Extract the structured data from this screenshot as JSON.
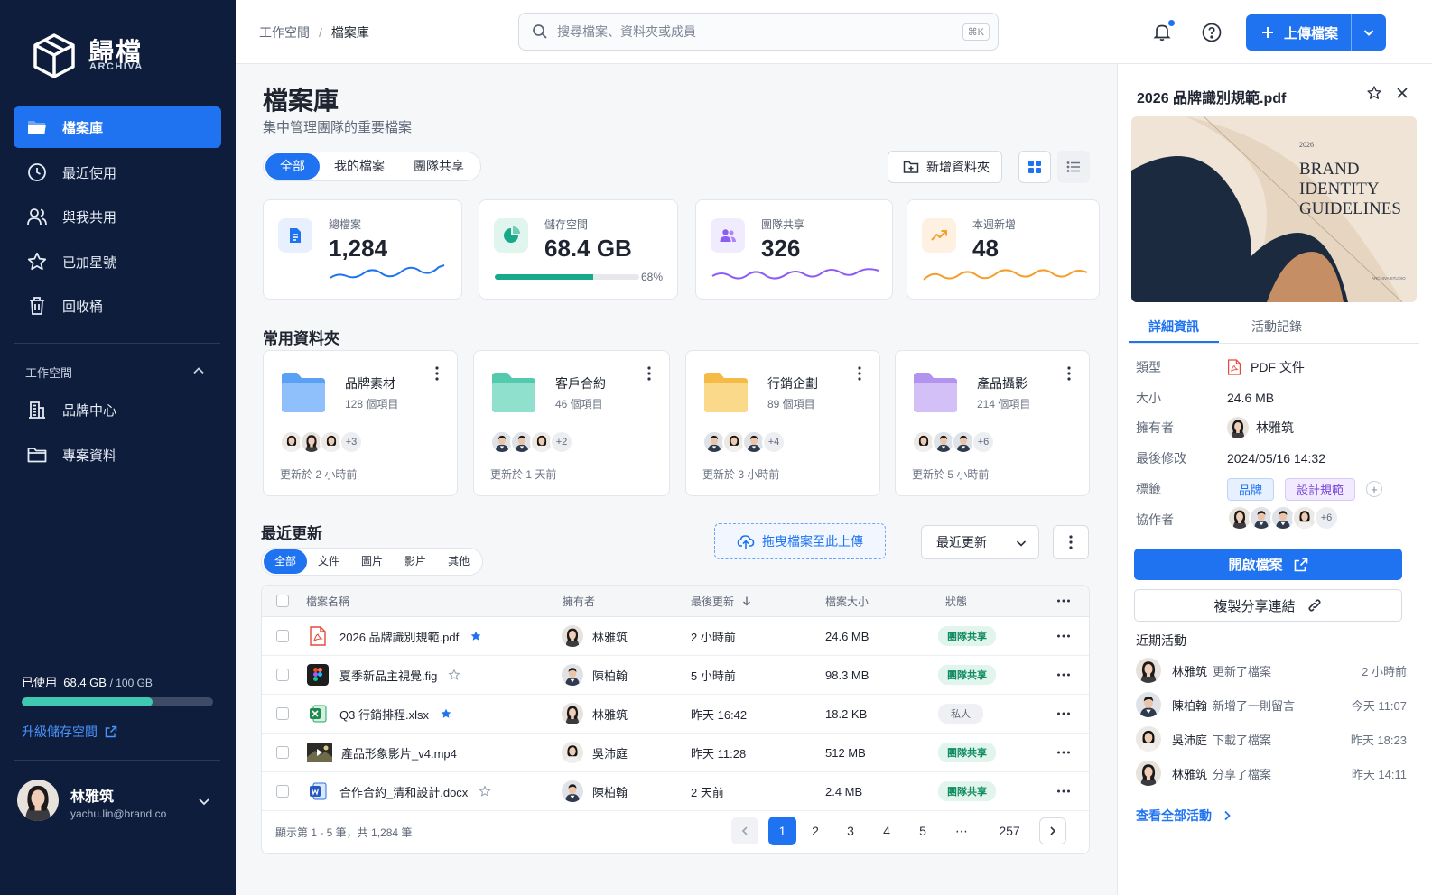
{
  "brand": {
    "name": "歸檔",
    "sub": "ARCHIVA"
  },
  "sidebar": {
    "nav": [
      {
        "label": "檔案庫",
        "icon": "folder-icon",
        "active": true
      },
      {
        "label": "最近使用",
        "icon": "clock-icon"
      },
      {
        "label": "與我共用",
        "icon": "users-icon"
      },
      {
        "label": "已加星號",
        "icon": "star-icon"
      },
      {
        "label": "回收桶",
        "icon": "trash-icon"
      }
    ],
    "workspace_title": "工作空間",
    "workspaces": [
      {
        "label": "品牌中心",
        "icon": "building-icon"
      },
      {
        "label": "專案資料",
        "icon": "folder-outline-icon"
      }
    ],
    "storage": {
      "label": "已使用",
      "used": "68.4 GB",
      "total": "/ 100 GB",
      "percent": 0.684
    },
    "upgrade": "升級儲存空間",
    "user": {
      "name": "林雅筑",
      "email": "yachu.lin@brand.co"
    }
  },
  "topbar": {
    "breadcrumb": [
      "工作空間",
      "檔案庫"
    ],
    "breadcrumb_sep": "/",
    "search_placeholder": "搜尋檔案、資料夾或成員",
    "search_kbd": "⌘K",
    "upload": "上傳檔案"
  },
  "page": {
    "title": "檔案庫",
    "subtitle": "集中管理團隊的重要檔案",
    "segments": [
      "全部",
      "我的檔案",
      "團隊共享"
    ],
    "new_folder": "新增資料夾"
  },
  "stats": [
    {
      "label": "總檔案",
      "value": "1,284",
      "color": "#1f73f1",
      "bg": "#e8f0fe",
      "icon": "document-icon"
    },
    {
      "label": "儲存空間",
      "value": "68.4 GB",
      "percent": "68%",
      "progress": 0.68,
      "color": "#18a88a",
      "bg": "#e1f5ef",
      "icon": "pie-chart-icon"
    },
    {
      "label": "團隊共享",
      "value": "326",
      "color": "#8b5cf6",
      "bg": "#f1ebfe",
      "icon": "team-icon"
    },
    {
      "label": "本週新增",
      "value": "48",
      "color": "#f59e2c",
      "bg": "#fff1e2",
      "icon": "trend-up-icon"
    }
  ],
  "folders_title": "常用資料夾",
  "folders": [
    {
      "name": "品牌素材",
      "count": "128 個項目",
      "more": "+3",
      "updated": "更新於 2 小時前",
      "color": "#5aa0f5",
      "color2": "#8fc0fb"
    },
    {
      "name": "客戶合約",
      "count": "46 個項目",
      "more": "+2",
      "updated": "更新於 1 天前",
      "color": "#53c9ae",
      "color2": "#8fe0cd"
    },
    {
      "name": "行銷企劃",
      "count": "89 個項目",
      "more": "+4",
      "updated": "更新於 3 小時前",
      "color": "#f5bb46",
      "color2": "#fbd98a"
    },
    {
      "name": "產品攝影",
      "count": "214 個項目",
      "more": "+6",
      "updated": "更新於 5 小時前",
      "color": "#b294ee",
      "color2": "#d2c0f7"
    }
  ],
  "recent": {
    "title": "最近更新",
    "tabs": [
      "全部",
      "文件",
      "圖片",
      "影片",
      "其他"
    ],
    "dropzone": "拖曳檔案至此上傳",
    "sort": "最近更新",
    "columns": [
      "檔案名稱",
      "擁有者",
      "最後更新",
      "檔案大小",
      "狀態"
    ],
    "rows": [
      {
        "name": "2026 品牌識別規範.pdf",
        "type": "pdf",
        "starred": true,
        "owner": "林雅筑",
        "updated": "2 小時前",
        "size": "24.6 MB",
        "status": "團隊共享",
        "private": false
      },
      {
        "name": "夏季新品主視覺.fig",
        "type": "fig",
        "starred": false,
        "owner": "陳柏翰",
        "updated": "5 小時前",
        "size": "98.3 MB",
        "status": "團隊共享",
        "private": false
      },
      {
        "name": "Q3 行銷排程.xlsx",
        "type": "xlsx",
        "starred": true,
        "owner": "林雅筑",
        "updated": "昨天 16:42",
        "size": "18.2 KB",
        "status": "私人",
        "private": true
      },
      {
        "name": "產品形象影片_v4.mp4",
        "type": "mp4",
        "starred": false,
        "owner": "吳沛庭",
        "updated": "昨天 11:28",
        "size": "512 MB",
        "status": "團隊共享",
        "private": false
      },
      {
        "name": "合作合約_清和設計.docx",
        "type": "docx",
        "starred": false,
        "owner": "陳柏翰",
        "updated": "2 天前",
        "size": "2.4 MB",
        "status": "團隊共享",
        "private": false
      }
    ],
    "footer": "顯示第 1 - 5 筆，共 1,284 筆",
    "pages": [
      "1",
      "2",
      "3",
      "4",
      "5",
      "⋯",
      "257"
    ]
  },
  "detail": {
    "title": "2026 品牌識別規範.pdf",
    "preview": {
      "year": "2026",
      "line1": "BRAND",
      "line2": "IDENTITY",
      "line3": "GUIDELINES",
      "studio": "ARCHIVA STUDIO"
    },
    "tabs": [
      "詳細資訊",
      "活動記錄"
    ],
    "fields": [
      {
        "label": "類型",
        "value": "PDF 文件"
      },
      {
        "label": "大小",
        "value": "24.6 MB"
      },
      {
        "label": "擁有者",
        "value": "林雅筑"
      },
      {
        "label": "最後修改",
        "value": "2024/05/16 14:32"
      },
      {
        "label": "標籤",
        "tags": [
          "品牌",
          "設計規範"
        ]
      },
      {
        "label": "協作者",
        "more": "+6"
      }
    ],
    "open": "開啟檔案",
    "copy": "複製分享連結",
    "activity_title": "近期活動",
    "activity": [
      {
        "name": "林雅筑",
        "action": "更新了檔案",
        "time": "2 小時前"
      },
      {
        "name": "陳柏翰",
        "action": "新增了一則留言",
        "time": "今天 11:07"
      },
      {
        "name": "吳沛庭",
        "action": "下載了檔案",
        "time": "昨天 18:23"
      },
      {
        "name": "林雅筑",
        "action": "分享了檔案",
        "time": "昨天 14:11"
      }
    ],
    "see_all": "查看全部活動"
  },
  "colors": {
    "accent": "#1f73f1",
    "sidebar": "#0e1d3b",
    "success": "#128c64"
  }
}
